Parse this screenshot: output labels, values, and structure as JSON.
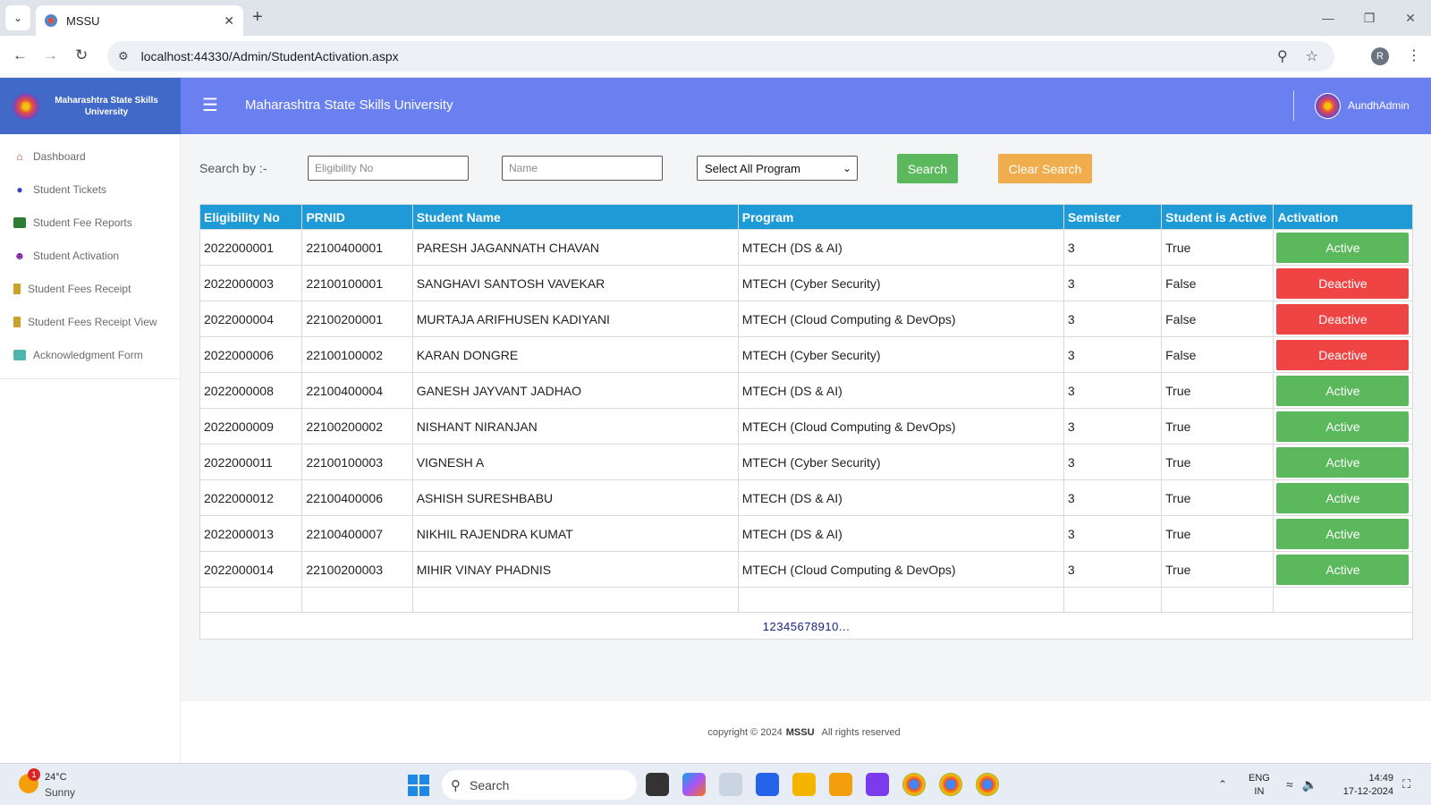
{
  "browser": {
    "tab_title": "MSSU",
    "url": "localhost:44330/Admin/StudentActivation.aspx",
    "profile_initial": "R"
  },
  "header": {
    "brand_name": "Maharashtra State Skills University",
    "app_title": "Maharashtra State Skills University",
    "user_name": "AundhAdmin"
  },
  "sidebar": {
    "items": [
      {
        "label": "Dashboard",
        "icon": "home-icon"
      },
      {
        "label": "Student Tickets",
        "icon": "tickets-icon"
      },
      {
        "label": "Student Fee Reports",
        "icon": "money-icon"
      },
      {
        "label": "Student Activation",
        "icon": "user-check-icon"
      },
      {
        "label": "Student Fees Receipt",
        "icon": "receipt-icon"
      },
      {
        "label": "Student Fees Receipt View",
        "icon": "receipt-view-icon"
      },
      {
        "label": "Acknowledgment Form",
        "icon": "form-icon"
      }
    ]
  },
  "search": {
    "label": "Search by :-",
    "eligibility_placeholder": "Eligibility No",
    "name_placeholder": "Name",
    "program_selected": "Select All Program",
    "search_button": "Search",
    "clear_button": "Clear Search"
  },
  "table": {
    "headers": [
      "Eligibility No",
      "PRNID",
      "Student Name",
      "Program",
      "Semister",
      "Student is Active",
      "Activation"
    ],
    "rows": [
      {
        "eligibility": "2022000001",
        "prnid": "22100400001",
        "name": "PARESH JAGANNATH CHAVAN",
        "program": "MTECH (DS & AI)",
        "semester": "3",
        "is_active": "True",
        "action": "Active"
      },
      {
        "eligibility": "2022000003",
        "prnid": "22100100001",
        "name": "SANGHAVI SANTOSH VAVEKAR",
        "program": "MTECH (Cyber Security)",
        "semester": "3",
        "is_active": "False",
        "action": "Deactive"
      },
      {
        "eligibility": "2022000004",
        "prnid": "22100200001",
        "name": "MURTAJA ARIFHUSEN KADIYANI",
        "program": "MTECH (Cloud Computing & DevOps)",
        "semester": "3",
        "is_active": "False",
        "action": "Deactive"
      },
      {
        "eligibility": "2022000006",
        "prnid": "22100100002",
        "name": "KARAN DONGRE",
        "program": "MTECH (Cyber Security)",
        "semester": "3",
        "is_active": "False",
        "action": "Deactive"
      },
      {
        "eligibility": "2022000008",
        "prnid": "22100400004",
        "name": "GANESH JAYVANT JADHAO",
        "program": "MTECH (DS & AI)",
        "semester": "3",
        "is_active": "True",
        "action": "Active"
      },
      {
        "eligibility": "2022000009",
        "prnid": "22100200002",
        "name": "NISHANT NIRANJAN",
        "program": "MTECH (Cloud Computing & DevOps)",
        "semester": "3",
        "is_active": "True",
        "action": "Active"
      },
      {
        "eligibility": "2022000011",
        "prnid": "22100100003",
        "name": "VIGNESH A",
        "program": "MTECH (Cyber Security)",
        "semester": "3",
        "is_active": "True",
        "action": "Active"
      },
      {
        "eligibility": "2022000012",
        "prnid": "22100400006",
        "name": "ASHISH SURESHBABU",
        "program": "MTECH (DS & AI)",
        "semester": "3",
        "is_active": "True",
        "action": "Active"
      },
      {
        "eligibility": "2022000013",
        "prnid": "22100400007",
        "name": "NIKHIL RAJENDRA KUMAT",
        "program": "MTECH (DS & AI)",
        "semester": "3",
        "is_active": "True",
        "action": "Active"
      },
      {
        "eligibility": "2022000014",
        "prnid": "22100200003",
        "name": "MIHIR VINAY PHADNIS",
        "program": "MTECH (Cloud Computing & DevOps)",
        "semester": "3",
        "is_active": "True",
        "action": "Active"
      }
    ],
    "pager": [
      "1",
      "2",
      "3",
      "4",
      "5",
      "6",
      "7",
      "8",
      "9",
      "10",
      "..."
    ]
  },
  "footer": {
    "prefix": "copyright © 2024",
    "brand": "MSSU",
    "suffix": "All rights reserved"
  },
  "taskbar": {
    "weather_badge": "1",
    "temperature": "24°C",
    "condition": "Sunny",
    "search_label": "Search",
    "lang_line1": "ENG",
    "lang_line2": "IN",
    "time": "14:49",
    "date": "17-12-2024"
  },
  "colors": {
    "brand_blue": "#4169c8",
    "header_blue": "#6a7ff0",
    "table_header": "#1e9ad6",
    "active_green": "#5cb85c",
    "deactive_red": "#ef4444",
    "clear_orange": "#f0ad4e"
  }
}
